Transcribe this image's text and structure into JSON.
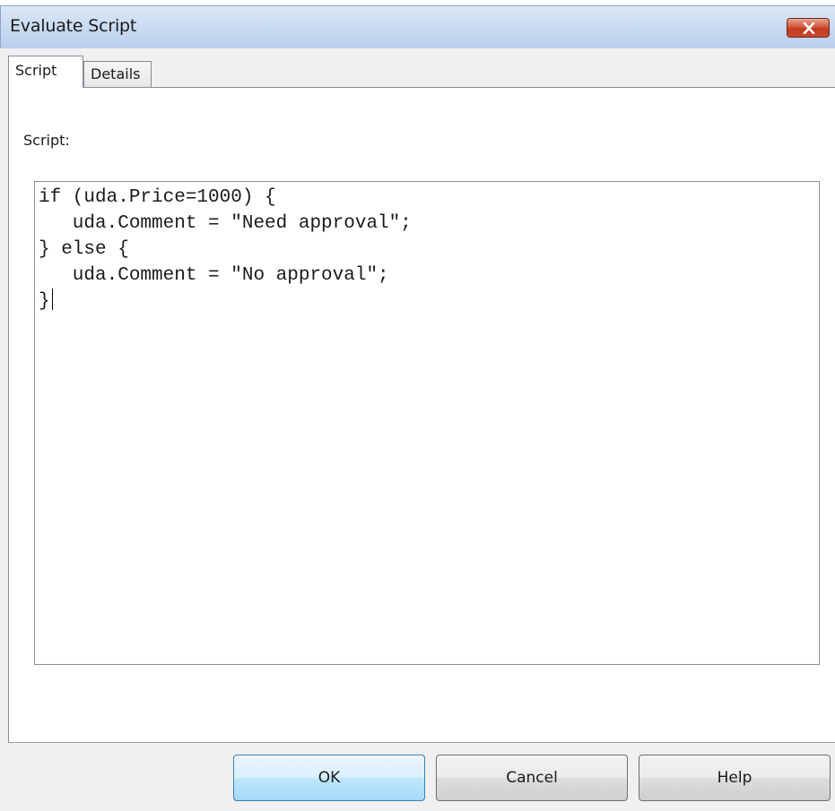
{
  "window": {
    "title": "Evaluate Script"
  },
  "tabs": [
    {
      "label": "Script",
      "active": true
    },
    {
      "label": "Details",
      "active": false
    }
  ],
  "script": {
    "label": "Script:",
    "lines": [
      "if (uda.Price=1000) {",
      "   uda.Comment = \"Need approval\";",
      "} else {",
      "   uda.Comment = \"No approval\";",
      "}"
    ]
  },
  "buttons": {
    "ok": "OK",
    "cancel": "Cancel",
    "help": "Help"
  },
  "icons": {
    "close": "close-icon"
  },
  "colors": {
    "close_button": "#c84a2e",
    "default_button_border": "#3c7fb1",
    "titlebar": "#c8dbf1"
  }
}
